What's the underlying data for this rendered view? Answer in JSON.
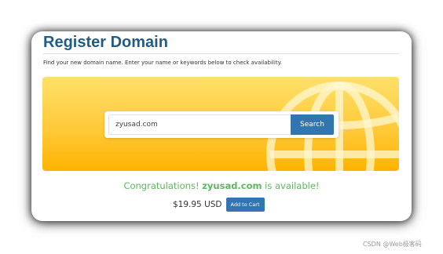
{
  "header": {
    "title": "Register Domain",
    "subtitle": "Find your new domain name. Enter your name or keywords below to check availability."
  },
  "search": {
    "value": "zyusad.com",
    "button_label": "Search"
  },
  "banner": {
    "icon": "globe-icon",
    "colors": {
      "top": "#ffe06a",
      "bottom": "#ffb300"
    }
  },
  "result": {
    "prefix": "Congratulations!",
    "domain": "zyusad.com",
    "suffix": "is available!",
    "price": "$19.95 USD",
    "add_to_cart_label": "Add to Cart"
  },
  "colors": {
    "title": "#1f5d85",
    "button": "#3276b1",
    "success": "#5cb85c"
  },
  "watermark": "CSDN @Web极客码"
}
